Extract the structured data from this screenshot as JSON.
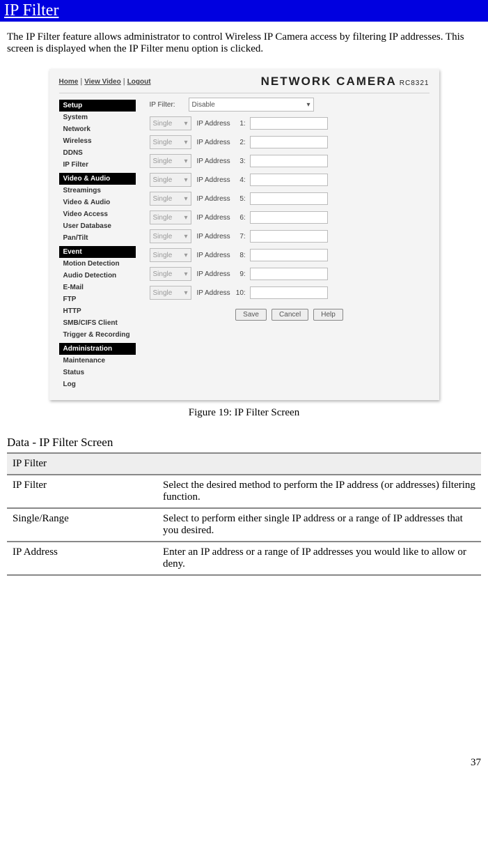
{
  "header": "IP Filter",
  "intro": "The IP Filter feature allows administrator to control Wireless IP Camera access by filtering IP addresses. This screen is displayed when the IP Filter menu option is clicked.",
  "figure_caption": "Figure 19: IP Filter Screen",
  "section_title": "Data - IP Filter Screen",
  "page_number": "37",
  "screenshot": {
    "links": {
      "home": "Home",
      "view": "View Video",
      "logout": "Logout"
    },
    "brand": "NETWORK CAMERA",
    "model": "RC8321",
    "sidebar": [
      {
        "hdr": "Setup",
        "items": [
          "System",
          "Network",
          "Wireless",
          "DDNS",
          "IP Filter"
        ]
      },
      {
        "hdr": "Video & Audio",
        "items": [
          "Streamings",
          "Video & Audio",
          "Video Access",
          "User Database",
          "Pan/Tilt"
        ]
      },
      {
        "hdr": "Event",
        "items": [
          "Motion Detection",
          "Audio Detection",
          "E-Mail",
          "FTP",
          "HTTP",
          "SMB/CIFS Client",
          "Trigger & Recording"
        ]
      },
      {
        "hdr": "Administration",
        "items": [
          "Maintenance",
          "Status",
          "Log"
        ]
      }
    ],
    "filter_label": "IP Filter:",
    "filter_value": "Disable",
    "type_value": "Single",
    "address_label": "IP Address",
    "rows": [
      "1:",
      "2:",
      "3:",
      "4:",
      "5:",
      "6:",
      "7:",
      "8:",
      "9:",
      "10:"
    ],
    "buttons": {
      "save": "Save",
      "cancel": "Cancel",
      "help": "Help"
    }
  },
  "table": {
    "group": "IP Filter",
    "rows": [
      {
        "k": "IP Filter",
        "v": "Select the desired method to perform the IP address (or addresses) filtering function."
      },
      {
        "k": "Single/Range",
        "v": "Select to perform either single IP address or a range of IP addresses that you desired."
      },
      {
        "k": "IP Address",
        "v": "Enter an IP address or a range of IP addresses you would like to allow or deny."
      }
    ]
  }
}
